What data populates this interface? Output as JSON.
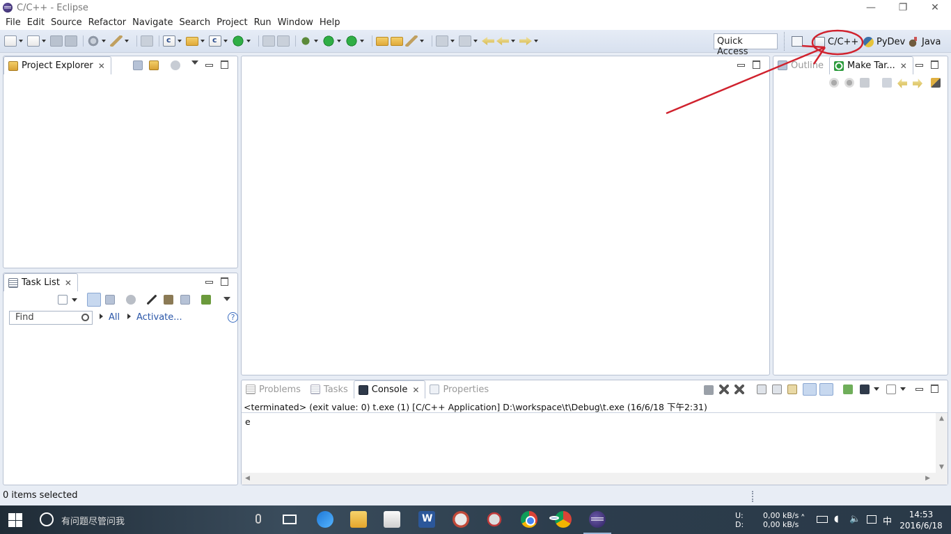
{
  "window": {
    "title": "C/C++ - Eclipse"
  },
  "menu": [
    "File",
    "Edit",
    "Source",
    "Refactor",
    "Navigate",
    "Search",
    "Project",
    "Run",
    "Window",
    "Help"
  ],
  "toolbar": {
    "quick_access": "Quick Access",
    "perspectives": {
      "cpp": "C/C++",
      "pydev": "PyDev",
      "java": "Java"
    }
  },
  "project_explorer": {
    "tab_label": "Project Explorer"
  },
  "task_list": {
    "tab_label": "Task List",
    "find_placeholder": "Find",
    "filter_all": "All",
    "activate": "Activate...",
    "help": "?"
  },
  "right_panel": {
    "outline_label": "Outline",
    "make_targets_label": "Make Tar..."
  },
  "bottom_panel": {
    "tabs": {
      "problems": "Problems",
      "tasks": "Tasks",
      "console": "Console",
      "properties": "Properties"
    },
    "status_line": "<terminated> (exit value: 0) t.exe (1) [C/C++ Application] D:\\workspace\\t\\Debug\\t.exe (16/6/18 下午2:31)",
    "output": "e"
  },
  "statusbar": {
    "text": "0 items selected"
  },
  "taskbar": {
    "search_text": "有问题尽管问我",
    "net_up_label": "U:",
    "net_down_label": "D:",
    "net_up": "0,00 kB/s",
    "net_down": "0,00 kB/s",
    "ime": "中",
    "time": "14:53",
    "date": "2016/6/18"
  },
  "colors": {
    "annotation": "#d0222e",
    "link": "#2a56a8"
  }
}
